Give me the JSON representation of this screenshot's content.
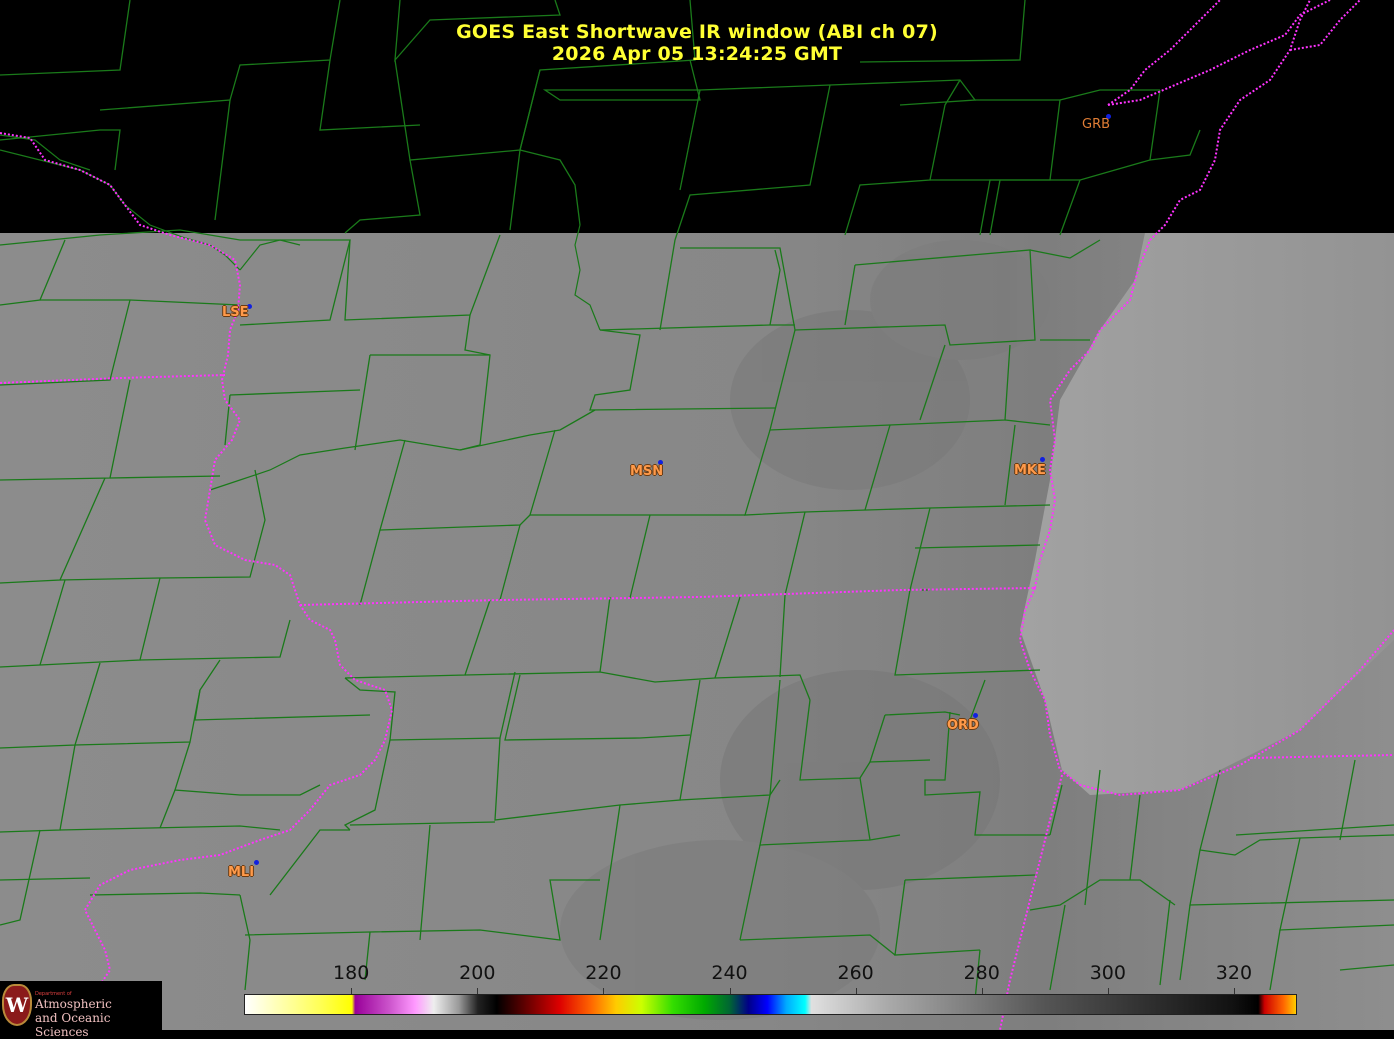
{
  "title": {
    "line1": "GOES East Shortwave IR window (ABI ch 07)",
    "line2": "2026 Apr 05  13:24:25 GMT"
  },
  "stations": [
    {
      "id": "GRB",
      "style": "dark"
    },
    {
      "id": "LSE",
      "style": "boxed"
    },
    {
      "id": "MSN",
      "style": "boxed"
    },
    {
      "id": "MKE",
      "style": "boxed"
    },
    {
      "id": "ORD",
      "style": "boxed"
    },
    {
      "id": "MLI",
      "style": "boxed"
    }
  ],
  "colorbar": {
    "min": 163,
    "max": 330,
    "ticks": [
      "180",
      "200",
      "220",
      "240",
      "260",
      "280",
      "300",
      "320"
    ]
  },
  "logo": {
    "dept": "Department of",
    "line1": "Atmospheric",
    "line2": "and Oceanic Sciences"
  },
  "colors": {
    "county_lines": "#1a7a1a",
    "state_lines": "#ff33ff",
    "title_text": "#ffff33",
    "station_text": "#ff9a4a",
    "station_dot": "#1020e0"
  }
}
